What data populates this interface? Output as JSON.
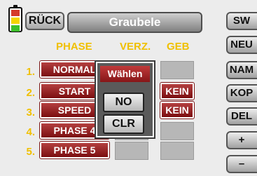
{
  "header": {
    "back_label": "RÜCK",
    "title": "Graubele"
  },
  "columns": {
    "phase": "PHASE",
    "delay": "VERZ.",
    "switch": "GEB"
  },
  "rows": [
    {
      "num": "1.",
      "name": "NORMAL",
      "switch": ""
    },
    {
      "num": "2.",
      "name": "START",
      "switch": "KEIN"
    },
    {
      "num": "3.",
      "name": "SPEED",
      "switch": "KEIN"
    },
    {
      "num": "4.",
      "name": "PHASE 4",
      "switch": ""
    },
    {
      "num": "5.",
      "name": "PHASE 5",
      "switch": ""
    }
  ],
  "side_buttons": [
    "SW",
    "NEU",
    "NAM",
    "KOP",
    "DEL",
    "+",
    "–"
  ],
  "dialog": {
    "title": "Wählen",
    "option_no": "NO",
    "option_clr": "CLR"
  },
  "colors": {
    "accent_yellow": "#f0c000",
    "button_red": "#7b0e10",
    "background": "#ececec"
  },
  "icons": {
    "battery": "battery-icon"
  }
}
